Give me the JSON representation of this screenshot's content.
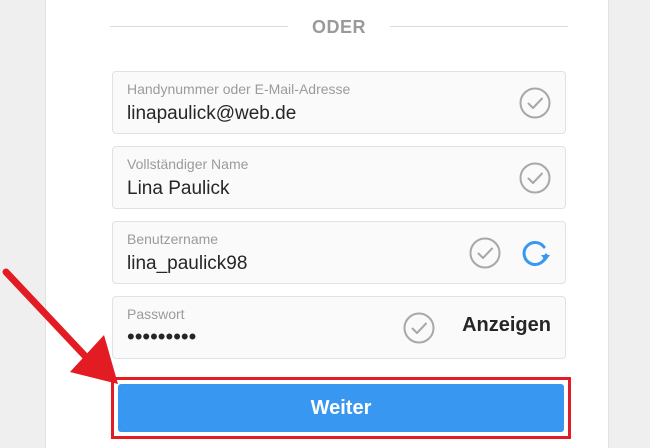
{
  "divider": {
    "text": "ODER"
  },
  "form": {
    "fields": [
      {
        "label": "Handynummer oder E-Mail-Adresse",
        "value": "linapaulick@web.de",
        "status": "check-icon"
      },
      {
        "label": "Vollständiger Name",
        "value": "Lina Paulick",
        "status": "check-icon"
      },
      {
        "label": "Benutzername",
        "value": "lina_paulick98",
        "status": "check-icon",
        "extra": "refresh-icon"
      },
      {
        "label": "Passwort",
        "value": "•••••••••",
        "status": "check-icon",
        "toggle_label": "Anzeigen"
      }
    ],
    "submit_label": "Weiter"
  },
  "colors": {
    "accent_blue": "#3897f0",
    "highlight_red": "#e31b23",
    "check_gray": "#a8a8a8"
  }
}
